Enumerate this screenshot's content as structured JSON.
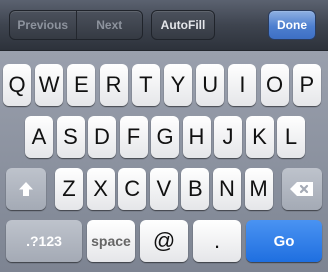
{
  "toolbar": {
    "previous_label": "Previous",
    "next_label": "Next",
    "autofill_label": "AutoFill",
    "done_label": "Done"
  },
  "keyboard": {
    "row1": [
      "Q",
      "W",
      "E",
      "R",
      "T",
      "Y",
      "U",
      "I",
      "O",
      "P"
    ],
    "row2": [
      "A",
      "S",
      "D",
      "F",
      "G",
      "H",
      "J",
      "K",
      "L"
    ],
    "row3": [
      "Z",
      "X",
      "C",
      "V",
      "B",
      "N",
      "M"
    ],
    "numbers_label": ".?123",
    "space_label": "space",
    "at_label": "@",
    "dot_label": ".",
    "go_label": "Go",
    "shift_icon": "shift-arrow-icon",
    "delete_icon": "backspace-icon",
    "colors": {
      "go_key": "#1f6fe0",
      "done_button": "#4e7fcf",
      "key_face": "#ffffff",
      "function_key": "#a4aab5"
    }
  }
}
